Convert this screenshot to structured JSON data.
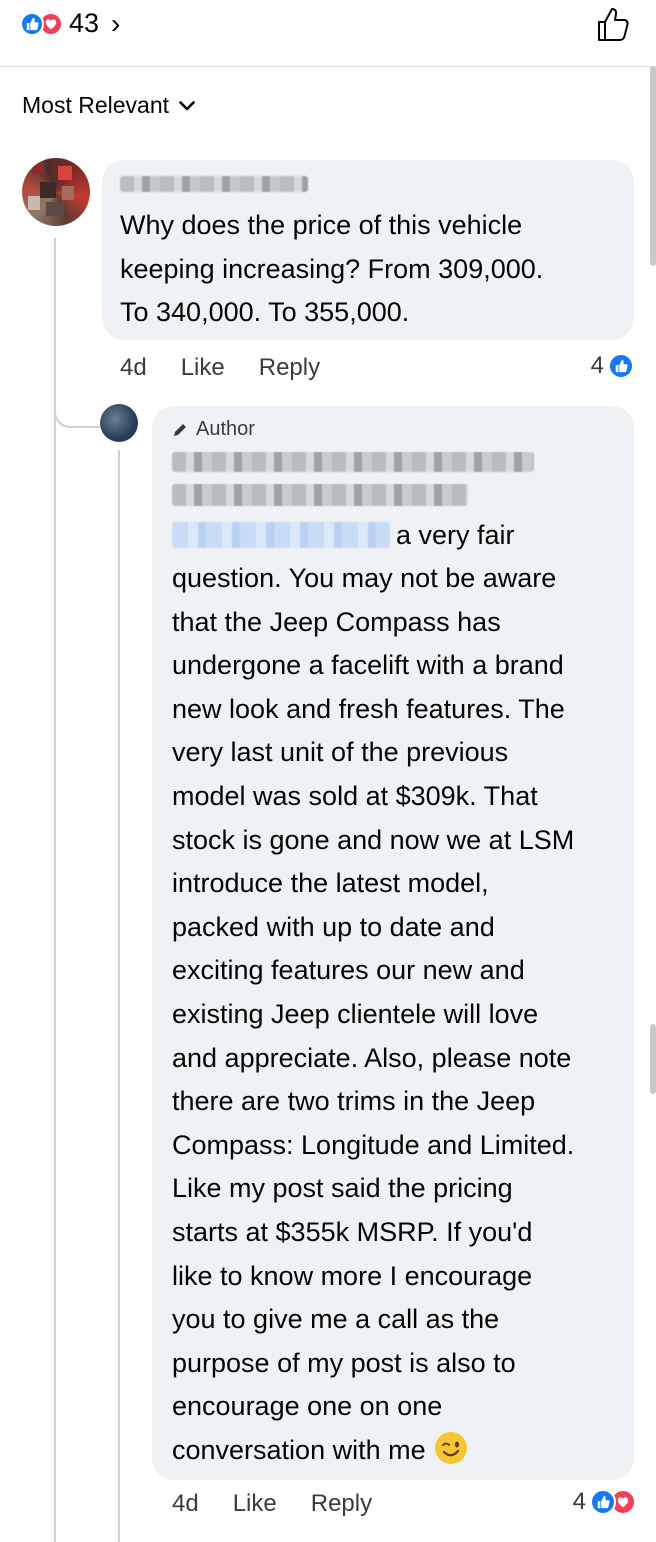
{
  "header": {
    "reaction_count": "43",
    "chevron": "›",
    "reaction_icons": [
      "like-icon",
      "love-icon"
    ],
    "like_button_icon": "thumbs-up-outline-icon"
  },
  "sort": {
    "label": "Most Relevant"
  },
  "comments": [
    {
      "name_redacted": true,
      "text_lines": [
        "Why does the price of this vehicle",
        "keeping increasing? From 309,000.",
        "To 340,000. To 355,000."
      ],
      "time": "4d",
      "like_label": "Like",
      "reply_label": "Reply",
      "reaction_count": "4"
    },
    {
      "badge": "Author",
      "name_redacted": true,
      "first_line_suffix": "a very fair",
      "text_lines": [
        "question. You may not be aware",
        "that the Jeep Compass has",
        "undergone a facelift with a brand",
        "new look and fresh features. The",
        "very last unit of the previous",
        "model was sold at $309k. That",
        "stock is gone and now we at LSM",
        "introduce the latest model,",
        "packed with up to date and",
        "exciting features our new and",
        "existing Jeep clientele will love",
        "and appreciate. Also, please note",
        "there are two trims in the Jeep",
        "Compass: Longitude and Limited.",
        "Like my post said the pricing",
        "starts at $355k MSRP. If you'd",
        "like to know more I encourage",
        "you to give me a call as the",
        "purpose of my post is also to",
        "encourage one on one",
        "conversation with me"
      ],
      "time": "4d",
      "like_label": "Like",
      "reply_label": "Reply",
      "reaction_count": "4"
    }
  ],
  "colors": {
    "like_blue": "#1877f2",
    "love_red": "#f33e58",
    "bubble": "#eff2f5"
  }
}
